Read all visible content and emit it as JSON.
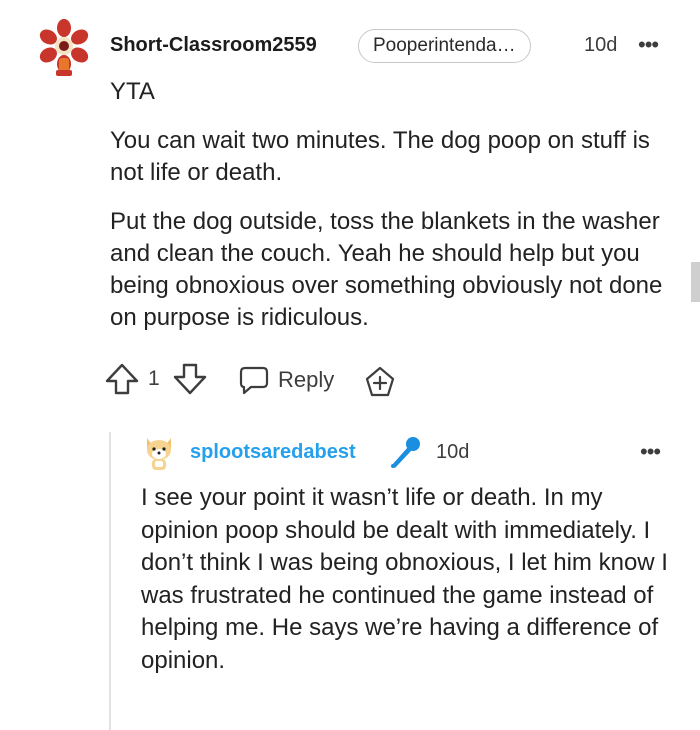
{
  "comment": {
    "username": "Short-Classroom2559",
    "flair": "Pooperintenda…",
    "age": "10d",
    "more": "•••",
    "paragraphs": [
      "YTA",
      "You can wait two minutes. The dog poop on stuff is not life or death.",
      "Put the dog outside, toss the blankets in the washer and clean the couch. Yeah he should help but you being obnoxious over something obviously not done on purpose is ridiculous."
    ],
    "vote_count": "1",
    "reply_label": "Reply"
  },
  "reply": {
    "username": "splootsaredabest",
    "age": "10d",
    "more": "•••",
    "body": "I see your point it wasn’t life or death. In my opinion poop should be dealt with immediately. I don’t think I was being obnoxious, I let him know I was frustrated he continued the game instead of helping me. He says we’re having a difference of opinion."
  },
  "icons": {
    "avatar1": "demogorgon-avatar",
    "avatar2": "shiba-dog-avatar",
    "op_badge": "microphone-icon",
    "upvote": "arrow-up-icon",
    "downvote": "arrow-down-icon",
    "reply": "speech-bubble-icon",
    "award": "plus-award-icon",
    "more": "more-options-icon"
  },
  "colors": {
    "username_op": "#24a0ed",
    "text": "#1c1c1c",
    "muted": "#3d3d3d"
  }
}
